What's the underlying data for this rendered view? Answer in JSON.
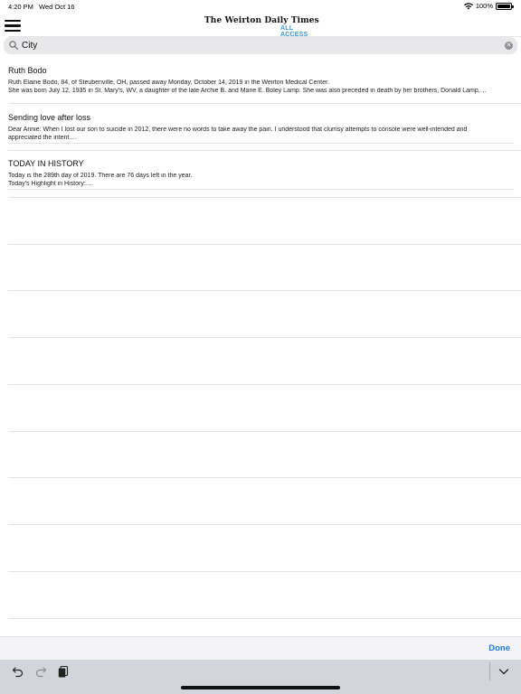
{
  "status_bar": {
    "time": "4:20 PM",
    "date": "Wed Oct 16",
    "battery": "100%"
  },
  "header": {
    "logo_title": "The Weirton Daily Times",
    "logo_subtitle": "ALL ACCESS",
    "accent_color": "#3a9ad9"
  },
  "search": {
    "value": "City",
    "placeholder": "Search"
  },
  "results": [
    {
      "title": "Ruth Bodo",
      "snippet_lines": [
        "Ruth Elaine Bodo, 84, of Steubenville, OH, passed away Monday, October 14, 2019 in the Weirton Medical Center.",
        "She was born July 12, 1935 in St. Mary's, WV, a daughter of the late Archie B. and Marie E. Boley Lamp. She was also preceded in death by her brothers, Donald Lamp,…"
      ]
    },
    {
      "title": "Sending love after loss",
      "snippet_lines": [
        "Dear Annie: When I lost our son to suicide in 2012, there were no words to take away the pain. I understood that clumsy attempts to console were well-intended and",
        "appreciated the intent.…"
      ]
    },
    {
      "title": "TODAY IN HISTORY",
      "snippet_lines": [
        "Today is the 289th day of 2019. There are 76 days left in the year.",
        "Today's Highlight in History:…"
      ]
    }
  ],
  "accessory": {
    "done_label": "Done",
    "done_color": "#1f7ae0"
  },
  "keyboard_bar": {
    "icons": [
      "undo-icon",
      "redo-icon",
      "paste-icon",
      "dismiss-keyboard-icon"
    ]
  }
}
